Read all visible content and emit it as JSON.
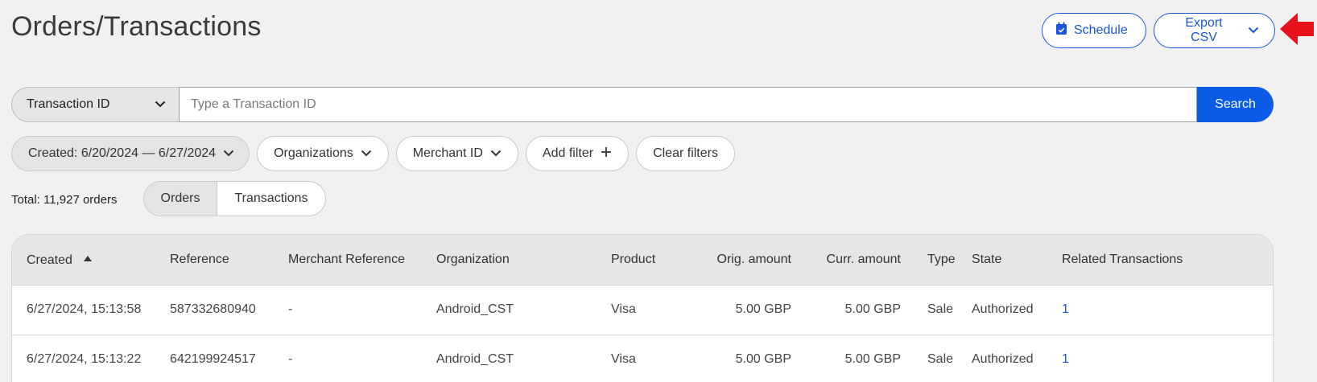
{
  "header": {
    "title": "Orders/Transactions",
    "schedule_label": "Schedule",
    "export_label": "Export CSV"
  },
  "search": {
    "type_label": "Transaction ID",
    "placeholder": "Type a Transaction ID",
    "value": "",
    "button_label": "Search"
  },
  "filters": {
    "date_label": "Created: 6/20/2024 — 6/27/2024",
    "organizations_label": "Organizations",
    "merchant_label": "Merchant ID",
    "add_filter_label": "Add filter",
    "clear_filters_label": "Clear filters"
  },
  "summary": {
    "total_label": "Total: 11,927 orders"
  },
  "view_toggle": {
    "orders_label": "Orders",
    "transactions_label": "Transactions",
    "selected": "Orders"
  },
  "table": {
    "columns": [
      "Created",
      "Reference",
      "Merchant Reference",
      "Organization",
      "Product",
      "Orig. amount",
      "Curr. amount",
      "Type",
      "State",
      "Related Transactions"
    ],
    "sort_column": "Created",
    "rows": [
      [
        "6/27/2024, 15:13:58",
        "587332680940",
        "-",
        "Android_CST",
        "Visa",
        "5.00 GBP",
        "5.00 GBP",
        "Sale",
        "Authorized",
        "1"
      ],
      [
        "6/27/2024, 15:13:22",
        "642199924517",
        "-",
        "Android_CST",
        "Visa",
        "5.00 GBP",
        "5.00 GBP",
        "Sale",
        "Authorized",
        "1"
      ]
    ]
  },
  "colors": {
    "accent": "#0a5ce6",
    "annotation_arrow": "#e8101a",
    "background": "#f1f1f1"
  }
}
